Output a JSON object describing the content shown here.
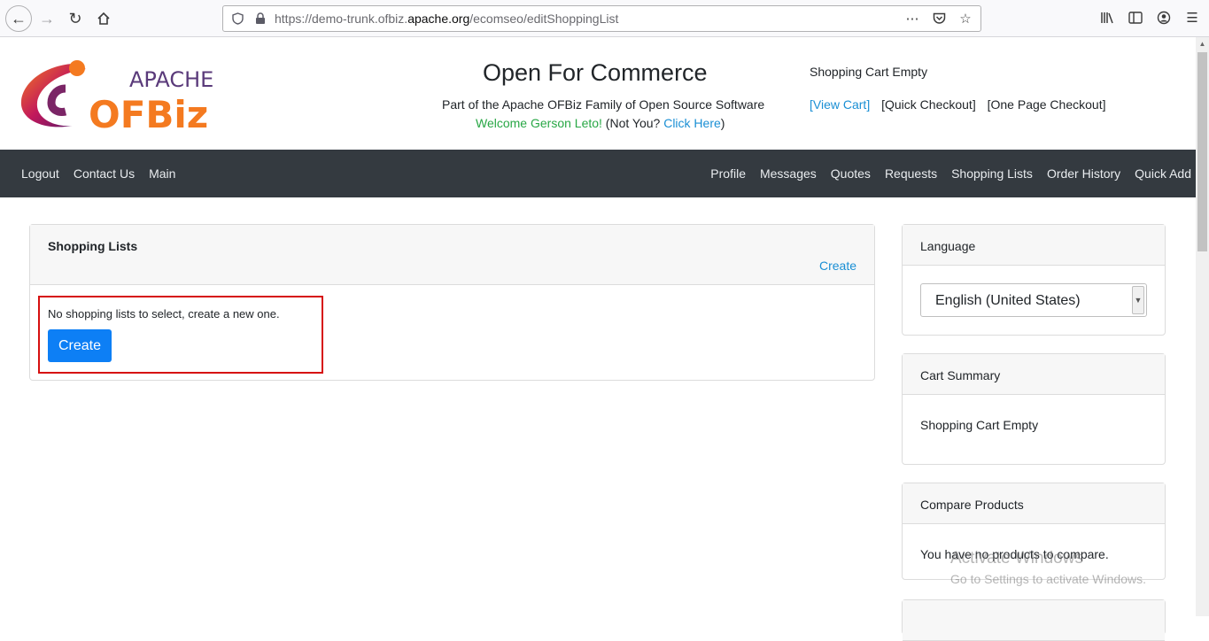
{
  "browser": {
    "url_prefix": "https://demo-trunk.ofbiz.",
    "url_domain": "apache.org",
    "url_path": "/ecomseo/editShoppingList"
  },
  "header": {
    "logo_top": "APACHE",
    "logo_bottom": "OFBiz",
    "title": "Open For Commerce",
    "subtitle": "Part of the Apache OFBiz Family of Open Source Software",
    "welcome": "Welcome Gerson Leto!",
    "not_you": " (Not You? ",
    "click_here": "Click Here",
    "close_paren": ")",
    "cart_status": "Shopping Cart Empty",
    "view_cart": "[View Cart]",
    "quick_checkout": "[Quick Checkout]",
    "one_page_checkout": "[One Page Checkout]"
  },
  "nav": {
    "left": [
      "Logout",
      "Contact Us",
      "Main"
    ],
    "right": [
      "Profile",
      "Messages",
      "Quotes",
      "Requests",
      "Shopping Lists",
      "Order History",
      "Quick Add"
    ]
  },
  "main": {
    "title": "Shopping Lists",
    "create_link": "Create",
    "empty_message": "No shopping lists to select, create a new one.",
    "create_button": "Create"
  },
  "sidebar": {
    "language_title": "Language",
    "language_value": "English (United States)",
    "cart_title": "Cart Summary",
    "cart_body": "Shopping Cart Empty",
    "compare_title": "Compare Products",
    "compare_body": "You have no products to compare."
  },
  "watermark": {
    "line1": "Activate Windows",
    "line2": "Go to Settings to activate Windows."
  }
}
